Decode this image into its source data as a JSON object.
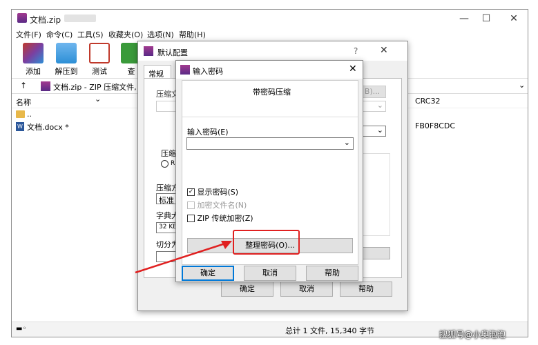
{
  "winrar": {
    "title": "文档.zip",
    "menus": [
      "文件(F)",
      "命令(C)",
      "工具(S)",
      "收藏夹(O)",
      "选项(N)",
      "帮助(H)"
    ],
    "tools": [
      {
        "label": "添加",
        "icon": "winrar-add-icon",
        "color": "#7b3fa0"
      },
      {
        "label": "解压到",
        "icon": "folder-extract-icon",
        "color": "#2d8fd6"
      },
      {
        "label": "测试",
        "icon": "clipboard-test-icon",
        "color": "#c0392b"
      },
      {
        "label": "查",
        "icon": "view-icon",
        "color": "#3a9a3a"
      }
    ],
    "address": "文档.zip - ZIP 压缩文件,",
    "columns": {
      "name": "名称",
      "crc": "CRC32"
    },
    "rows": [
      {
        "name": "..",
        "crc": ""
      },
      {
        "name": "文档.docx *",
        "crc": "FB0F8CDC"
      }
    ],
    "status": "总计 1 文件, 15,340 字节"
  },
  "settings_dlg": {
    "title": "默认配置",
    "help": "?",
    "tab": "常规",
    "ok": "确定",
    "cancel": "取消",
    "help_btn": "帮助",
    "frag_a": "压缩文",
    "frag_b": "压缩",
    "frag_c": "R",
    "frag_d": "压缩方",
    "frag_e": "标准",
    "frag_f": "字典大",
    "frag_g": "32 KB",
    "frag_h": "切分为",
    "frag_i": "B)..."
  },
  "password_dlg": {
    "title": "输入密码",
    "heading": "带密码压缩",
    "field_label": "输入密码(E)",
    "value": "",
    "show_password": "显示密码(S)",
    "encrypt_names": "加密文件名(N)",
    "zip_legacy": "ZIP 传统加密(Z)",
    "manage": "整理密码(O)...",
    "ok": "确定",
    "cancel": "取消",
    "help": "帮助"
  },
  "watermark": "搜狐号@小奥泡泡",
  "colors": {
    "highlight": "#e02020",
    "accent": "#0078d7"
  }
}
